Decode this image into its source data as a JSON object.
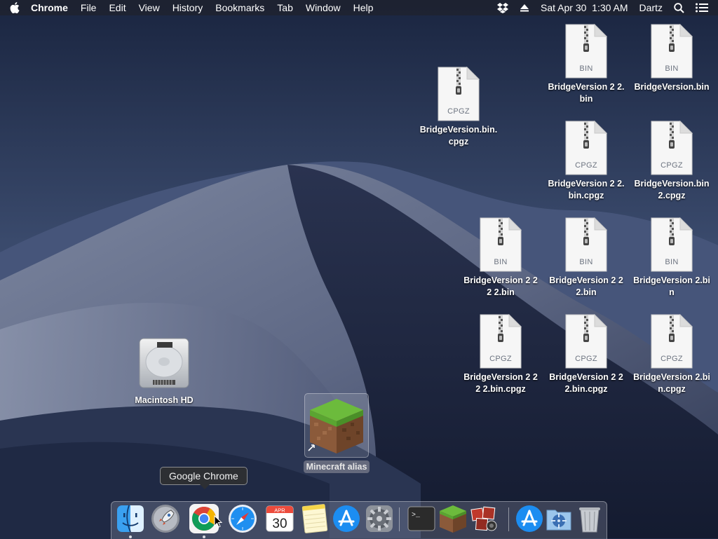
{
  "menubar": {
    "app_name": "Chrome",
    "menus": [
      "File",
      "Edit",
      "View",
      "History",
      "Bookmarks",
      "Tab",
      "Window",
      "Help"
    ],
    "datetime": "Sat Apr 30  1:30 AM",
    "user": "Dartz",
    "status_icons": [
      "dropbox-icon",
      "eject-icon",
      "spotlight-icon",
      "notification-center-icon"
    ]
  },
  "desktop": {
    "files": [
      {
        "label": "BridgeVersion 2 2.bin",
        "ext": "BIN"
      },
      {
        "label": "BridgeVersion.bin",
        "ext": "BIN"
      },
      {
        "label": "BridgeVersion.bin.cpgz",
        "ext": "CPGZ"
      },
      {
        "label": "BridgeVersion 2 2.bin.cpgz",
        "ext": "CPGZ"
      },
      {
        "label": "BridgeVersion.bin 2.cpgz",
        "ext": "CPGZ"
      },
      {
        "label": "BridgeVersion 2 2 2 2.bin",
        "ext": "BIN"
      },
      {
        "label": "BridgeVersion 2 2 2.bin",
        "ext": "BIN"
      },
      {
        "label": "BridgeVersion 2.bin",
        "ext": "BIN"
      },
      {
        "label": "BridgeVersion 2 2 2 2.bin.cpgz",
        "ext": "CPGZ"
      },
      {
        "label": "BridgeVersion 2 2 2.bin.cpgz",
        "ext": "CPGZ"
      },
      {
        "label": "BridgeVersion 2.bin.cpgz",
        "ext": "CPGZ"
      }
    ],
    "hard_drive_label": "Macintosh HD",
    "alias_label": "Minecraft alias"
  },
  "tooltip": "Google Chrome",
  "dock": {
    "calendar_month": "APR",
    "calendar_day": "30",
    "apps": [
      "finder-icon",
      "launchpad-icon",
      "chrome-icon",
      "safari-icon",
      "calendar-icon",
      "notes-icon",
      "app-store-icon",
      "system-preferences-icon",
      "terminal-icon",
      "minecraft-icon",
      "photo-booth-icon",
      "downloads-app-store-icon",
      "utilities-icon",
      "trash-icon"
    ]
  },
  "colors": {
    "menubar_bg": "#1e222e",
    "tooltip_bg": "#2d2f33",
    "chrome_red": "#db4437",
    "chrome_green": "#0f9d58",
    "chrome_yellow": "#f4b400",
    "chrome_blue": "#4285f4"
  }
}
